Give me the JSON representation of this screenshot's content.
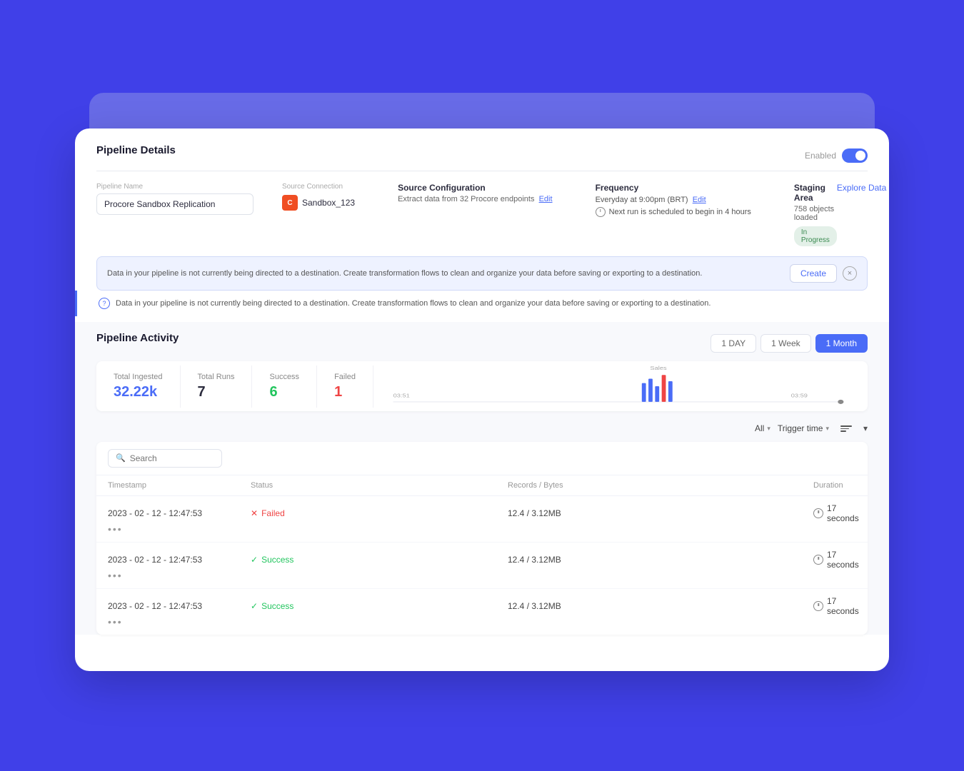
{
  "page": {
    "title": "Pipeline Details"
  },
  "header": {
    "enabled_label": "Enabled",
    "toggle_on": true
  },
  "pipeline": {
    "name_label": "Pipeline Name",
    "name_value": "Procore Sandbox Replication",
    "source_connection_label": "Source Connection",
    "source_icon_text": "C",
    "source_name": "Sandbox_123",
    "source_config_title": "Source Configuration",
    "source_config_desc": "Extract data from 32 Procore endpoints",
    "source_config_edit": "Edit",
    "frequency_title": "Frequency",
    "frequency_value": "Everyday at 9:00pm (BRT)",
    "frequency_edit": "Edit",
    "next_run_text": "Next run is scheduled to begin in 4 hours",
    "staging_area_title": "Staging Area",
    "staging_area_count": "758 objects loaded",
    "staging_status": "In Progress",
    "explore_data": "Explore Data"
  },
  "create_popup": {
    "text": "Data in your pipeline is not currently being directed to a destination. Create transformation flows to clean and organize your data before saving or exporting to a destination.",
    "create_label": "Create",
    "close_label": "×"
  },
  "info_bar": {
    "text": "Data in your pipeline is not currently being directed to a destination. Create transformation flows to clean and organize your data before saving or exporting to a destination."
  },
  "activity": {
    "title": "Pipeline Activity",
    "time_buttons": [
      {
        "label": "1 DAY",
        "active": false
      },
      {
        "label": "1 Week",
        "active": false
      },
      {
        "label": "1 Month",
        "active": true
      }
    ],
    "stats": {
      "total_ingested_label": "Total Ingested",
      "total_ingested_value": "32.22k",
      "total_runs_label": "Total Runs",
      "total_runs_value": "7",
      "success_label": "Success",
      "success_value": "6",
      "failed_label": "Failed",
      "failed_value": "1"
    },
    "chart_labels": [
      "03:51",
      "03:59"
    ],
    "chart_bar_label": "Sales",
    "filter_all_label": "All",
    "filter_trigger_label": "Trigger time",
    "search_placeholder": "Search",
    "table": {
      "headers": [
        "Timestamp",
        "Status",
        "",
        "Records / Bytes",
        "Duration",
        ""
      ],
      "rows": [
        {
          "timestamp": "2023 - 02 - 12 - 12:47:53",
          "status": "Failed",
          "status_type": "failed",
          "records": "12.4 / 3.12MB",
          "duration": "17 seconds"
        },
        {
          "timestamp": "2023 - 02 - 12 - 12:47:53",
          "status": "Success",
          "status_type": "success",
          "records": "12.4 / 3.12MB",
          "duration": "17 seconds"
        },
        {
          "timestamp": "2023 - 02 - 12 - 12:47:53",
          "status": "Success",
          "status_type": "success",
          "records": "12.4 / 3.12MB",
          "duration": "17 seconds"
        }
      ]
    }
  }
}
